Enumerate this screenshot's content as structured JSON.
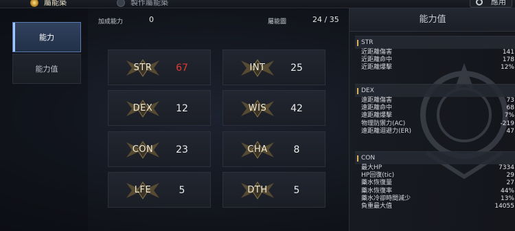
{
  "top_tabs": [
    {
      "label": "屬能築",
      "active": true
    },
    {
      "label": "製作屬能築",
      "active": false
    }
  ],
  "top_right_button": {
    "label": "應用"
  },
  "sidebar": {
    "items": [
      {
        "label": "能力",
        "active": true
      },
      {
        "label": "能力值",
        "active": false
      }
    ]
  },
  "header": {
    "bonus_label": "加成能力",
    "bonus_value": "0",
    "points_label": "屬能圖",
    "points_value": "24 / 35"
  },
  "stats": [
    {
      "name": "STR",
      "value": "67",
      "highlight": true
    },
    {
      "name": "INT",
      "value": "25",
      "highlight": false
    },
    {
      "name": "DEX",
      "value": "12",
      "highlight": false
    },
    {
      "name": "WIS",
      "value": "42",
      "highlight": false
    },
    {
      "name": "CON",
      "value": "23",
      "highlight": false
    },
    {
      "name": "CHA",
      "value": "8",
      "highlight": false
    },
    {
      "name": "LFE",
      "value": "5",
      "highlight": false
    },
    {
      "name": "DTH",
      "value": "5",
      "highlight": false
    }
  ],
  "colors": {
    "highlight_value": "#e33a32",
    "accent": "#d9b45c",
    "active_tab": "#31425e"
  },
  "right_panel": {
    "title": "能力值",
    "groups": [
      {
        "name": "STR",
        "rows": [
          {
            "label": "近距離傷害",
            "value": "141"
          },
          {
            "label": "近距離命中",
            "value": "178"
          },
          {
            "label": "近距離爆擊",
            "value": "12%"
          }
        ]
      },
      {
        "name": "DEX",
        "rows": [
          {
            "label": "遠距離傷害",
            "value": "73"
          },
          {
            "label": "遠距離命中",
            "value": "68"
          },
          {
            "label": "遠距離爆擊",
            "value": "7%"
          },
          {
            "label": "物理防禦力(AC)",
            "value": "-219"
          },
          {
            "label": "遠距離迴避力(ER)",
            "value": "47"
          }
        ]
      },
      {
        "name": "CON",
        "rows": [
          {
            "label": "最大HP",
            "value": "7334"
          },
          {
            "label": "HP回復(tic)",
            "value": "29"
          },
          {
            "label": "藥水恢復量",
            "value": "27"
          },
          {
            "label": "藥水恢復率",
            "value": "44%"
          },
          {
            "label": "藥水冷卻時間減少",
            "value": "13%"
          },
          {
            "label": "負重最大值",
            "value": "14055"
          }
        ]
      }
    ]
  }
}
